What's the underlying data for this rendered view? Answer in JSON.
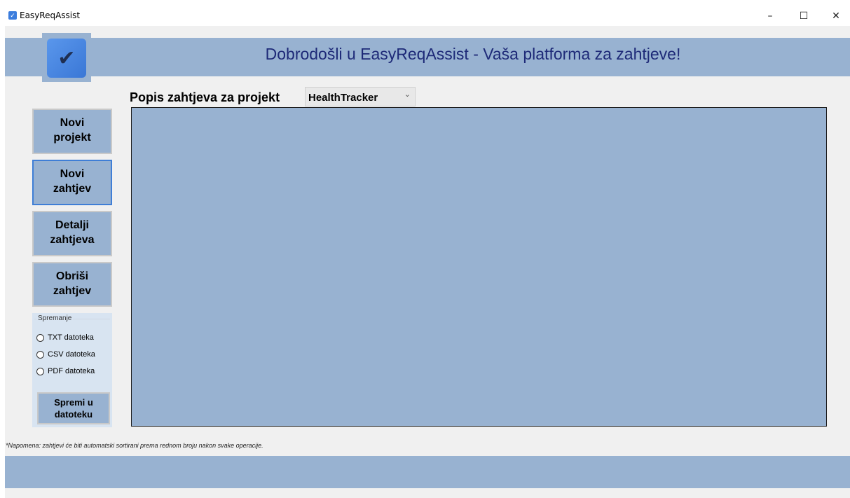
{
  "window": {
    "title": "EasyReqAssist",
    "app_icon": "checkbox-icon",
    "controls": {
      "minimize": "–",
      "maximize": "☐",
      "close": "✕"
    }
  },
  "header": {
    "logo_icon": "check-icon",
    "logo_glyph": "✔",
    "title": "Dobrodošli u EasyReqAssist - Vaša platforma za zahtjeve!"
  },
  "project": {
    "label": "Popis zahtjeva za projekt",
    "selected": "HealthTracker",
    "chevron": "⌄"
  },
  "sidebar": {
    "buttons": [
      {
        "line1": "Novi",
        "line2": "projekt"
      },
      {
        "line1": "Novi",
        "line2": "zahtjev"
      },
      {
        "line1": "Detalji",
        "line2": "zahtjeva"
      },
      {
        "line1": "Obriši",
        "line2": "zahtjev"
      }
    ]
  },
  "save": {
    "legend": "Spremanje",
    "options": [
      "TXT datoteka",
      "CSV datoteka",
      "PDF datoteka"
    ],
    "button_line1": "Spremi u",
    "button_line2": "datoteku"
  },
  "note": "*Napomena: zahtjevi će biti automatski sortirani prema rednom broju nakon svake operacije.",
  "colors": {
    "panel": "#98b2d1",
    "title_text": "#1e2a78",
    "background": "#f0f0f0"
  }
}
